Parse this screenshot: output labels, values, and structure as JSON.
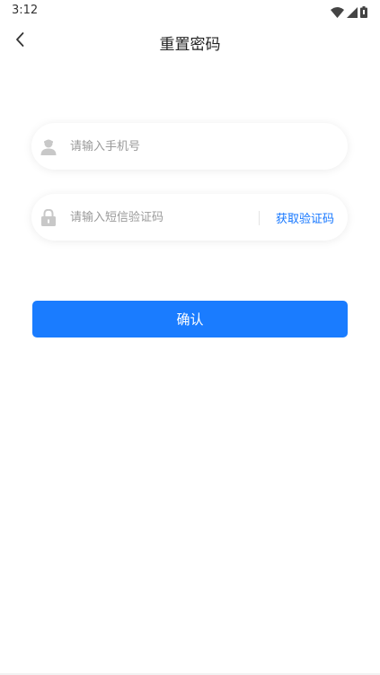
{
  "status_bar": {
    "time": "3:12",
    "icons": [
      "wifi-icon",
      "signal-icon",
      "battery-icon"
    ]
  },
  "nav": {
    "title": "重置密码",
    "back_icon": "chevron-left-icon"
  },
  "form": {
    "phone": {
      "placeholder": "请输入手机号",
      "value": "",
      "icon": "user-icon"
    },
    "sms_code": {
      "placeholder": "请输入短信验证码",
      "value": "",
      "icon": "lock-icon",
      "get_code_label": "获取验证码"
    },
    "confirm_label": "确认"
  },
  "colors": {
    "primary": "#1a7cff",
    "link": "#1677ff",
    "icon_gray": "#c8c8c8",
    "placeholder": "#9a9a9a"
  }
}
